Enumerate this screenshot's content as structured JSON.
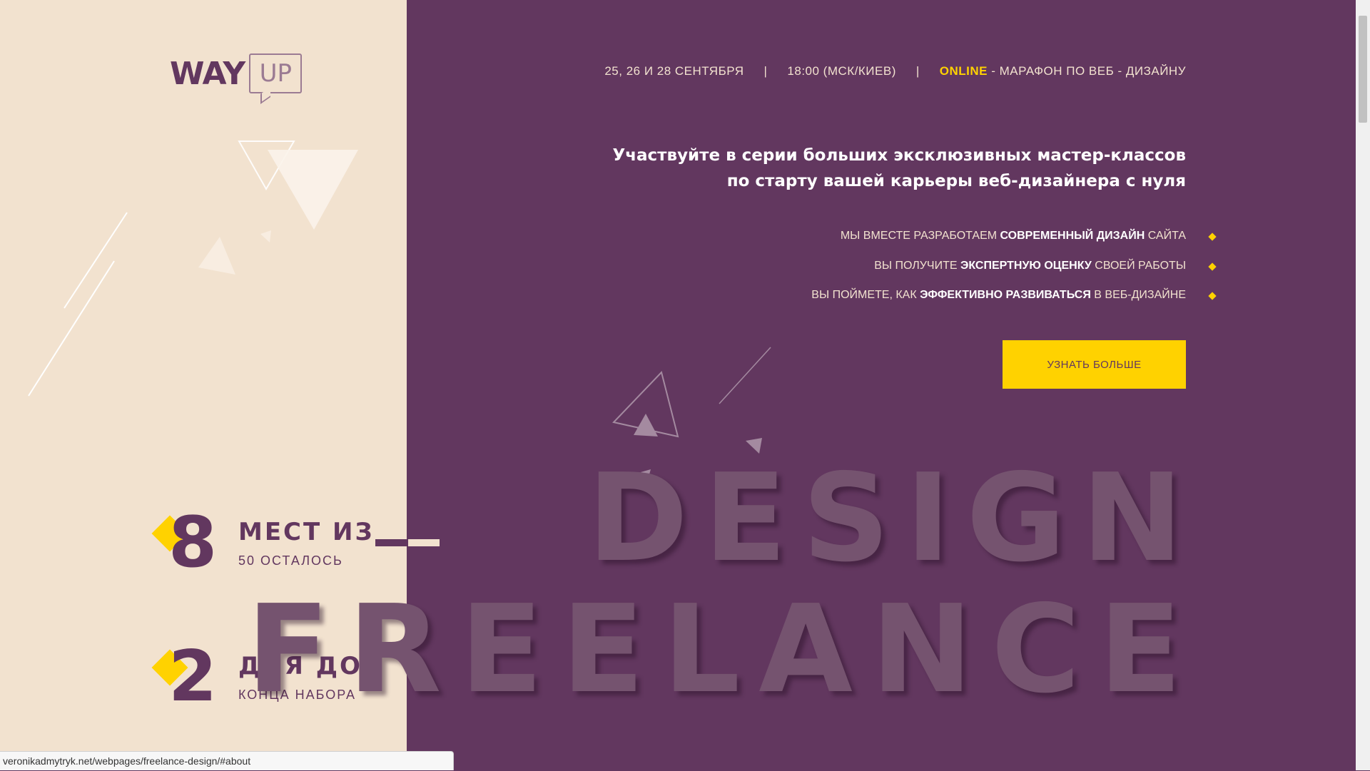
{
  "logo": {
    "way": "WAY",
    "up": "UP"
  },
  "header": {
    "dates": "25, 26 И 28 СЕНТЯБРЯ",
    "separator": "|",
    "time": "18:00 (МСК/КИЕВ)",
    "online": "ONLINE",
    "event": " - МАРАФОН ПО ВЕБ - ДИЗАЙНУ"
  },
  "headline": {
    "line1": "Участвуйте в серии больших эксклюзивных мастер-классов",
    "line2": "по старту вашей карьеры веб-дизайнера с нуля"
  },
  "features": [
    {
      "pre": "МЫ ВМЕСТЕ РАЗРАБОТАЕМ ",
      "bold": "СОВРЕМЕННЫЙ ДИЗАЙН",
      "post": " САЙТА"
    },
    {
      "pre": "ВЫ ПОЛУЧИТЕ ",
      "bold": "ЭКСПЕРТНУЮ ОЦЕНКУ",
      "post": " СВОЕЙ РАБОТЫ"
    },
    {
      "pre": "ВЫ ПОЙМЕТЕ, КАК ",
      "bold": "ЭФФЕКТИВНО РАЗВИВАТЬСЯ",
      "post": " В ВЕБ-ДИЗАЙНЕ"
    }
  ],
  "cta": {
    "label": "УЗНАТЬ БОЛЬШЕ"
  },
  "counters": {
    "seats": {
      "number": "8",
      "big": "МЕСТ ИЗ",
      "small": "50 ОСТАЛОСЬ"
    },
    "days": {
      "number": "2",
      "big": "ДНЯ ДО",
      "small": "КОНЦА НАБОРА"
    }
  },
  "background_words": {
    "design": "DESIGN",
    "freelance": "FREELANCE"
  },
  "status_bar": {
    "url": "veronikadmytryk.net/webpages/freelance-design/#about"
  },
  "colors": {
    "purple": "#62375f",
    "beige": "#f2e2cf",
    "yellow": "#ffd200"
  }
}
